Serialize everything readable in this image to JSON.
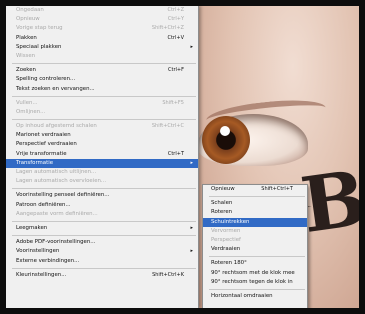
{
  "menu": {
    "items": [
      {
        "label": "Ongedaan",
        "shortcut": "Ctrl+Z",
        "disabled": true
      },
      {
        "label": "Opnieuw",
        "shortcut": "Ctrl+Y",
        "disabled": true
      },
      {
        "label": "Vorige stap terug",
        "shortcut": "Shift+Ctrl+Z",
        "disabled": true
      },
      {
        "label": "Plakken",
        "shortcut": "Ctrl+V",
        "disabled": false
      },
      {
        "label": "Speciaal plakken",
        "shortcut": "",
        "disabled": false,
        "arrow": true
      },
      {
        "label": "Wissen",
        "shortcut": "",
        "disabled": true
      },
      {
        "sep": true
      },
      {
        "label": "Zoeken",
        "shortcut": "Ctrl+F",
        "disabled": false
      },
      {
        "label": "Spelling controleren...",
        "shortcut": "",
        "disabled": false
      },
      {
        "label": "Tekst zoeken en vervangen...",
        "shortcut": "",
        "disabled": false
      },
      {
        "sep": true
      },
      {
        "label": "Vullen...",
        "shortcut": "Shift+F5",
        "disabled": true
      },
      {
        "label": "Omlijnen...",
        "shortcut": "",
        "disabled": true
      },
      {
        "sep": true
      },
      {
        "label": "Op inhoud afgestemd schalen",
        "shortcut": "Shift+Ctrl+C",
        "disabled": true
      },
      {
        "label": "Marionet verdraaien",
        "shortcut": "",
        "disabled": false
      },
      {
        "label": "Perspectief verdraaien",
        "shortcut": "",
        "disabled": false
      },
      {
        "label": "Vrije transformatie",
        "shortcut": "Ctrl+T",
        "disabled": false
      },
      {
        "label": "Transformatie",
        "shortcut": "",
        "disabled": false,
        "arrow": true,
        "highlight": true
      },
      {
        "label": "Lagen automatisch uitlijnen...",
        "shortcut": "",
        "disabled": true
      },
      {
        "label": "Lagen automatisch overvloeien...",
        "shortcut": "",
        "disabled": true
      },
      {
        "sep": true
      },
      {
        "label": "Voorinstelling penseel definiëren...",
        "shortcut": "",
        "disabled": false
      },
      {
        "label": "Patroon definiëren...",
        "shortcut": "",
        "disabled": false
      },
      {
        "label": "Aangepaste vorm definiëren...",
        "shortcut": "",
        "disabled": true
      },
      {
        "sep": true
      },
      {
        "label": "Leegmaken",
        "shortcut": "",
        "disabled": false,
        "arrow": true
      },
      {
        "sep": true
      },
      {
        "label": "Adobe PDF-voorinstellingen...",
        "shortcut": "",
        "disabled": false
      },
      {
        "label": "Voorinstellingen",
        "shortcut": "",
        "disabled": false,
        "arrow": true
      },
      {
        "label": "Externe verbindingen...",
        "shortcut": "",
        "disabled": false
      },
      {
        "sep": true
      },
      {
        "label": "Kleurinstellingen...",
        "shortcut": "Shift+Ctrl+K",
        "disabled": false
      }
    ]
  },
  "submenu": {
    "items": [
      {
        "label": "Opnieuw",
        "shortcut": "Shift+Ctrl+T",
        "disabled": false
      },
      {
        "sep": true
      },
      {
        "label": "Schalen",
        "shortcut": "",
        "disabled": false
      },
      {
        "label": "Roteren",
        "shortcut": "",
        "disabled": false
      },
      {
        "label": "Schuintrekken",
        "shortcut": "",
        "disabled": false,
        "highlight": true
      },
      {
        "label": "Vervormen",
        "shortcut": "",
        "disabled": true
      },
      {
        "label": "Perspectief",
        "shortcut": "",
        "disabled": true
      },
      {
        "label": "Verdraaien",
        "shortcut": "",
        "disabled": false
      },
      {
        "sep": true
      },
      {
        "label": "Roteren 180°",
        "shortcut": "",
        "disabled": false
      },
      {
        "label": "90° rechtsom met de klok mee",
        "shortcut": "",
        "disabled": false
      },
      {
        "label": "90° rechtsom tegen de klok in",
        "shortcut": "",
        "disabled": false
      },
      {
        "sep": true
      },
      {
        "label": "Horizontaal omdraaien",
        "shortcut": "",
        "disabled": false
      }
    ]
  },
  "photo": {
    "tattoo_letter": "B"
  }
}
